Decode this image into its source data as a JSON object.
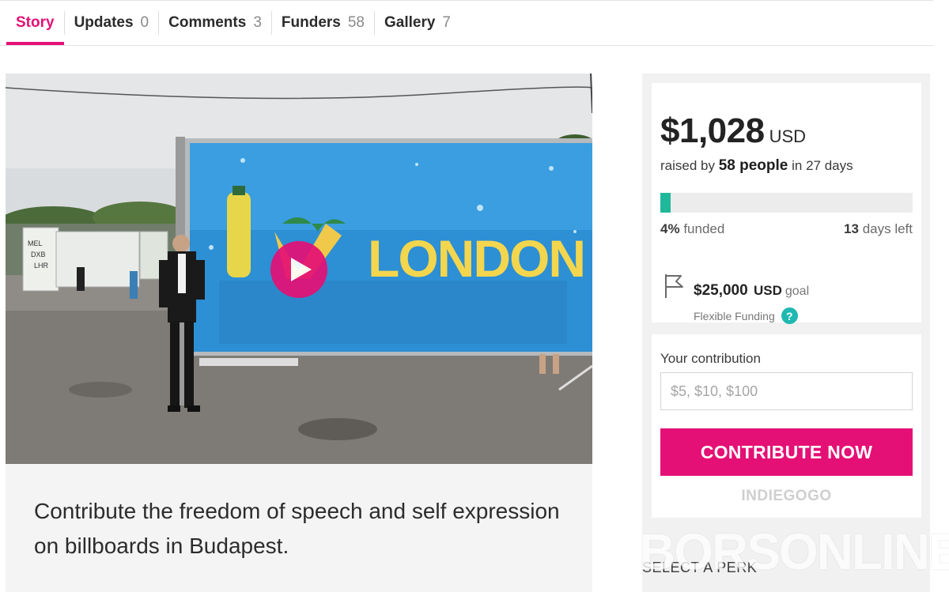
{
  "tabs": [
    {
      "label": "Story",
      "count": ""
    },
    {
      "label": "Updates",
      "count": "0"
    },
    {
      "label": "Comments",
      "count": "3"
    },
    {
      "label": "Funders",
      "count": "58"
    },
    {
      "label": "Gallery",
      "count": "7"
    }
  ],
  "media": {
    "billboard_text": "LONDON",
    "airport_codes": [
      "MEL",
      "DXB",
      "LHR"
    ],
    "play_icon": "play-icon"
  },
  "caption": "Contribute the freedom of speech and self expression on billboards in Budapest.",
  "funding": {
    "amount": "$1,028",
    "currency": "USD",
    "raised_prefix": "raised by",
    "people": "58 people",
    "raised_suffix": "in 27 days",
    "percent_funded": 4,
    "funded_pct": "4%",
    "funded_label": "funded",
    "days_left": "13",
    "days_label": "days left",
    "goal_amount": "$25,000",
    "goal_currency": "USD",
    "goal_label": "goal",
    "flexible_label": "Flexible Funding",
    "help_icon": "?"
  },
  "contribution": {
    "label": "Your contribution",
    "placeholder": "$5, $10, $100",
    "button": "CONTRIBUTE NOW",
    "brand": "INDIEGOGO"
  },
  "select_perk": "SELECT A PERK",
  "watermark": "BORSONLINE",
  "colors": {
    "accent": "#e51075",
    "progress": "#1fb89a",
    "help": "#1fb8b1"
  }
}
